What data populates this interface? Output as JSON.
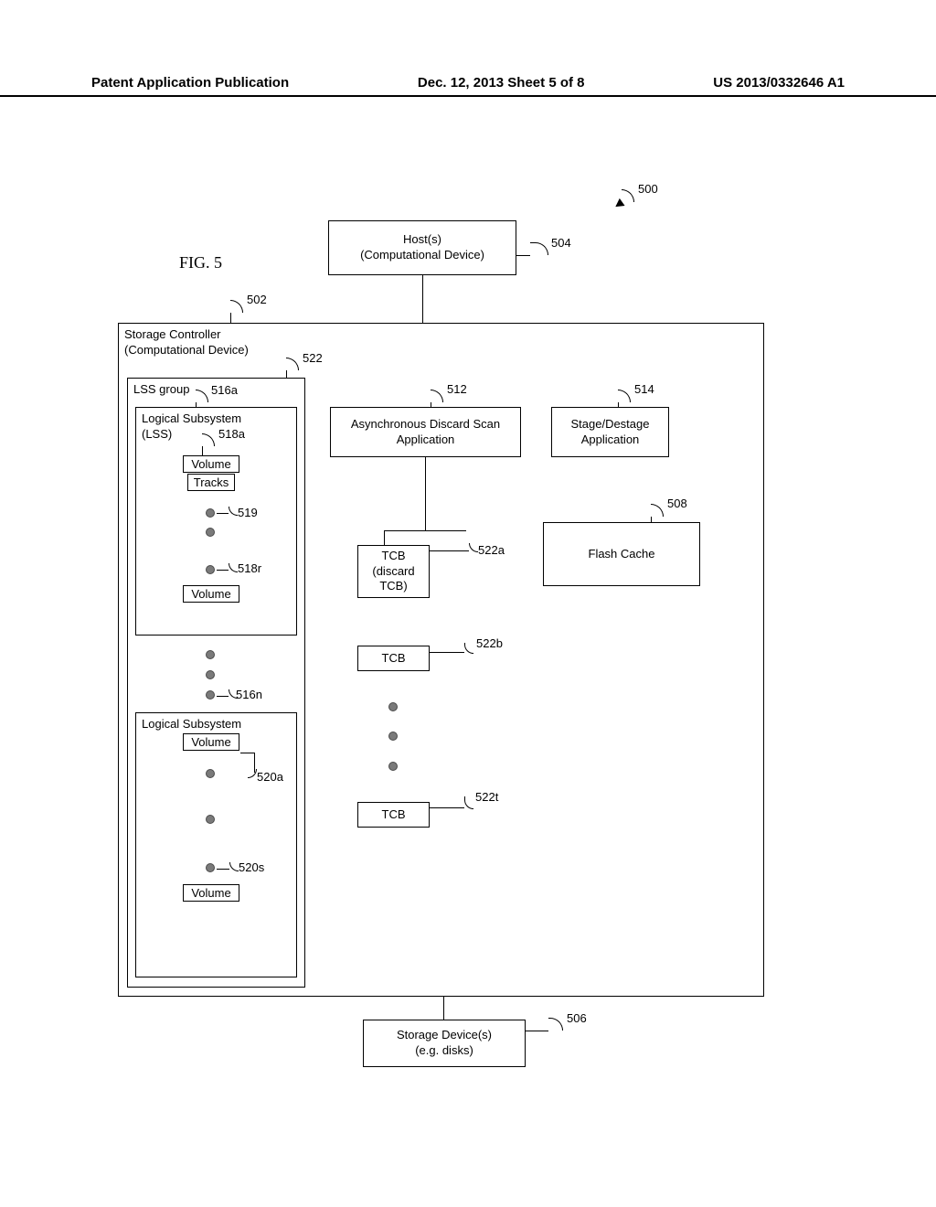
{
  "header": {
    "left": "Patent Application Publication",
    "center": "Dec. 12, 2013  Sheet 5 of 8",
    "right": "US 2013/0332646 A1"
  },
  "fig": {
    "label": "FIG. 5"
  },
  "refs": {
    "500": "500",
    "502": "502",
    "504": "504",
    "506": "506",
    "508": "508",
    "512": "512",
    "514": "514",
    "516a": "516a",
    "516n": "516n",
    "518a": "518a",
    "518r": "518r",
    "519": "519",
    "520a": "520a",
    "520s": "520s",
    "522": "522",
    "522a": "522a",
    "522b": "522b",
    "522t": "522t"
  },
  "boxes": {
    "hosts_l1": "Host(s)",
    "hosts_l2": "(Computational Device)",
    "storage_ctrl_l1": "Storage Controller",
    "storage_ctrl_l2": "(Computational Device)",
    "lss_group": "LSS group",
    "lss1_l1": "Logical Subsystem",
    "lss1_l2": "(LSS)",
    "volume": "Volume",
    "tracks": "Tracks",
    "lss2": "Logical Subsystem",
    "async_l1": "Asynchronous  Discard Scan",
    "async_l2": "Application",
    "stage_l1": "Stage/Destage",
    "stage_l2": "Application",
    "flash": "Flash Cache",
    "tcb": "TCB",
    "tcb_discard_l1": "TCB",
    "tcb_discard_l2": "(discard",
    "tcb_discard_l3": "TCB)",
    "storage_dev_l1": "Storage Device(s)",
    "storage_dev_l2": "(e.g. disks)"
  }
}
